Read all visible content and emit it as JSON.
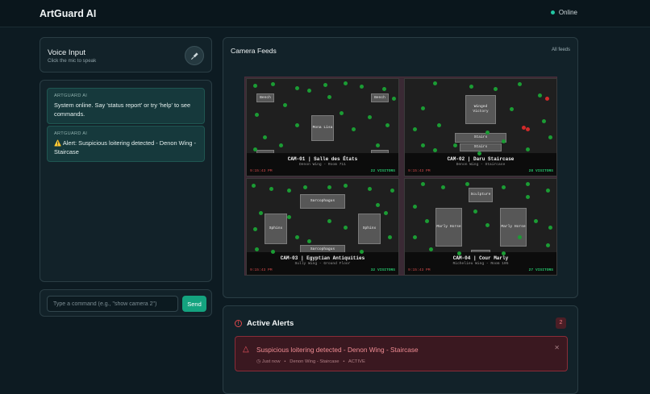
{
  "header": {
    "title": "ArtGuard AI",
    "status": "Online",
    "status_color": "#22c5a2"
  },
  "voice": {
    "title": "Voice Input",
    "subtitle": "Click the mic to speak",
    "mic_icon": "microphone-icon"
  },
  "chat": {
    "messages": [
      {
        "sender": "ARTGUARD AI",
        "text": "System online. Say 'status report' or try 'help' to see commands."
      },
      {
        "sender": "ARTGUARD AI",
        "text": "⚠️ Alert: Suspicious loitering detected - Denon Wing - Staircase"
      }
    ]
  },
  "command": {
    "placeholder": "Type a command (e.g., \"show camera 2\")",
    "value": "",
    "send_label": "Send"
  },
  "feeds": {
    "title": "Camera Feeds",
    "link": "All feeds",
    "cameras": [
      {
        "name": "CAM-01 | Salle des États",
        "location": "Denon Wing - Room 711",
        "time": "9:15:43 PM",
        "visitors": "22 VISITORS",
        "objects": [
          "Bench",
          "Bench",
          "Mona Lisa"
        ]
      },
      {
        "name": "CAM-02 | Daru Staircase",
        "location": "Denon Wing - Staircase",
        "time": "9:15:43 PM",
        "visitors": "28 VISITORS",
        "objects": [
          "Winged Victory",
          "Stairs",
          "Stairs"
        ]
      },
      {
        "name": "CAM-03 | Egyptian Antiquities",
        "location": "Sully Wing - Ground Floor",
        "time": "9:15:43 PM",
        "visitors": "32 VISITORS",
        "objects": [
          "Sarcophagus",
          "Sphinx",
          "Sphinx",
          "Sarcophagus"
        ]
      },
      {
        "name": "CAM-04 | Cour Marly",
        "location": "Richelieu Wing - Room 105",
        "time": "9:15:43 PM",
        "visitors": "27 VISITORS",
        "objects": [
          "Sculpture",
          "Marly Horse",
          "Marly Horse"
        ]
      }
    ]
  },
  "alerts": {
    "title": "Active Alerts",
    "count": "2",
    "items": [
      {
        "text": "Suspicious loitering detected - Denon Wing - Staircase",
        "time": "Just now",
        "location": "Denon Wing - Staircase",
        "state": "ACTIVE",
        "close": "✕"
      }
    ]
  }
}
